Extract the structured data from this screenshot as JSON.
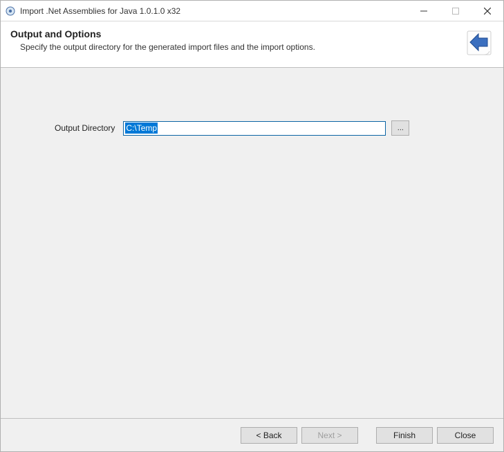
{
  "titlebar": {
    "title": "Import .Net Assemblies for Java 1.0.1.0 x32"
  },
  "header": {
    "title": "Output and Options",
    "description": "Specify the output directory for the generated import files and the import options."
  },
  "form": {
    "output_directory_label": "Output Directory",
    "output_directory_value": "C:\\Temp",
    "browse_label": "..."
  },
  "buttons": {
    "back": "< Back",
    "next": "Next >",
    "finish": "Finish",
    "close": "Close"
  }
}
